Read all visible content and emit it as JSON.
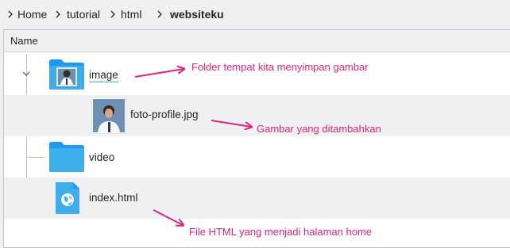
{
  "breadcrumb": {
    "items": [
      "Home",
      "tutorial",
      "html",
      "websiteku"
    ]
  },
  "view": {
    "column_header": "Name",
    "rows": [
      {
        "label": "image",
        "type": "folder-with-photo"
      },
      {
        "label": "foto-profile.jpg",
        "type": "photo"
      },
      {
        "label": "video",
        "type": "folder"
      },
      {
        "label": "index.html",
        "type": "html"
      }
    ]
  },
  "annotations": {
    "folder_note": "Folder tempat kita menyimpan gambar",
    "image_note": "Gambar yang ditambahkan",
    "file_note": "File HTML yang menjadi halaman home"
  },
  "colors": {
    "accent": "#3daee9",
    "annotation": "#e8237a",
    "folder": "#3daee9"
  }
}
